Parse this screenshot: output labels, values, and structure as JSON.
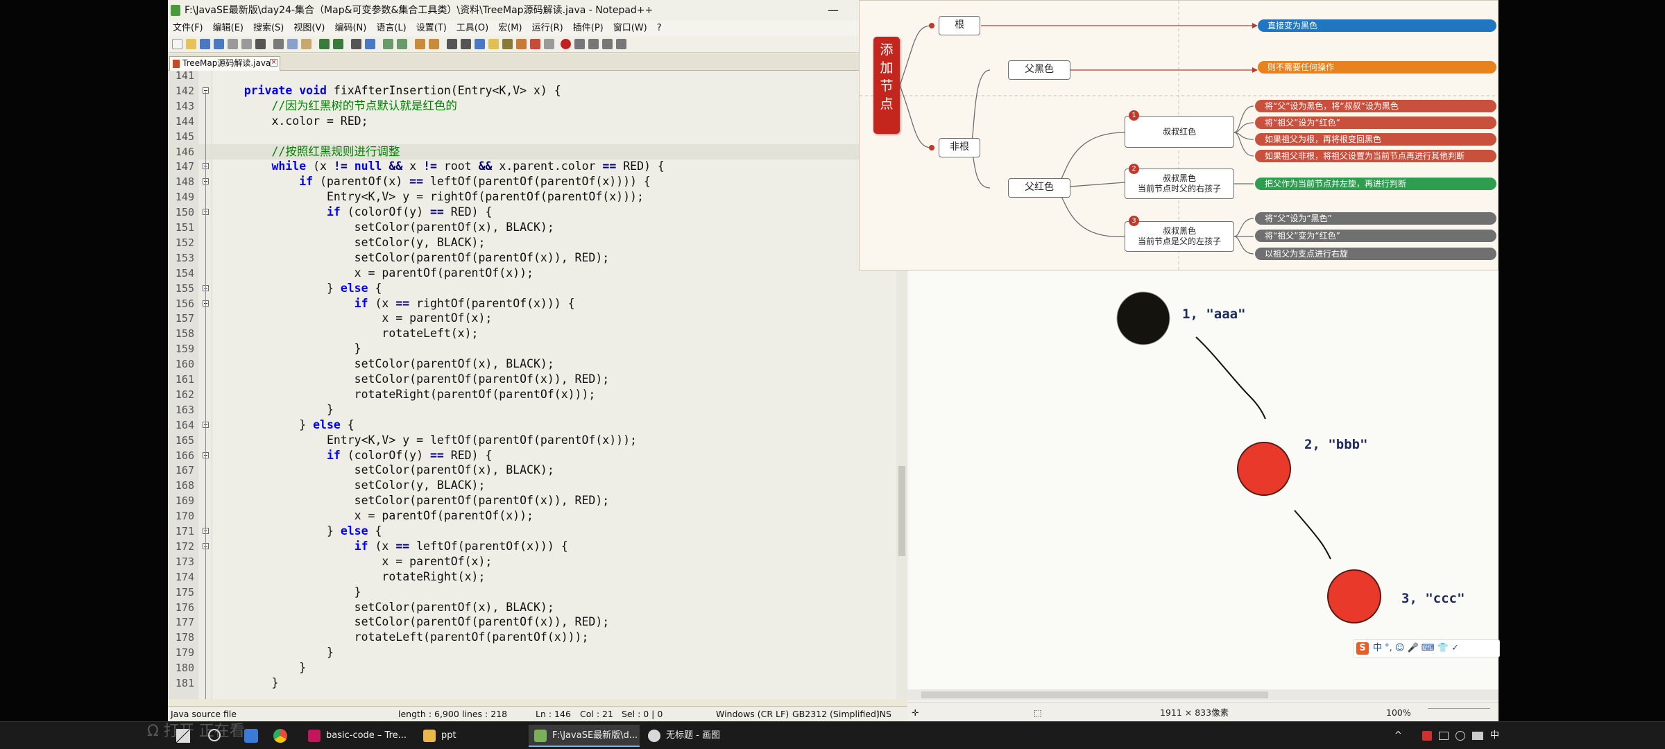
{
  "notepad": {
    "title": "F:\\JavaSE最新版\\day24-集合（Map&可变参数&集合工具类）\\资料\\TreeMap源码解读.java - Notepad++",
    "menu": [
      "文件(F)",
      "编辑(E)",
      "搜索(S)",
      "视图(V)",
      "编码(N)",
      "语言(L)",
      "设置(T)",
      "工具(O)",
      "宏(M)",
      "运行(R)",
      "插件(P)",
      "窗口(W)",
      "?"
    ],
    "tab_label": "TreeMap源码解读.java",
    "lines": [
      {
        "n": "141",
        "code": ""
      },
      {
        "n": "142",
        "code": "    private void fixAfterInsertion(Entry<K,V> x) {"
      },
      {
        "n": "143",
        "code": "        //因为红黑树的节点默认就是红色的"
      },
      {
        "n": "144",
        "code": "        x.color = RED;"
      },
      {
        "n": "145",
        "code": ""
      },
      {
        "n": "146",
        "code": "        //按照红黑规则进行调整"
      },
      {
        "n": "147",
        "code": "        while (x != null && x != root && x.parent.color == RED) {"
      },
      {
        "n": "148",
        "code": "            if (parentOf(x) == leftOf(parentOf(parentOf(x)))) {"
      },
      {
        "n": "149",
        "code": "                Entry<K,V> y = rightOf(parentOf(parentOf(x)));"
      },
      {
        "n": "150",
        "code": "                if (colorOf(y) == RED) {"
      },
      {
        "n": "151",
        "code": "                    setColor(parentOf(x), BLACK);"
      },
      {
        "n": "152",
        "code": "                    setColor(y, BLACK);"
      },
      {
        "n": "153",
        "code": "                    setColor(parentOf(parentOf(x)), RED);"
      },
      {
        "n": "154",
        "code": "                    x = parentOf(parentOf(x));"
      },
      {
        "n": "155",
        "code": "                } else {"
      },
      {
        "n": "156",
        "code": "                    if (x == rightOf(parentOf(x))) {"
      },
      {
        "n": "157",
        "code": "                        x = parentOf(x);"
      },
      {
        "n": "158",
        "code": "                        rotateLeft(x);"
      },
      {
        "n": "159",
        "code": "                    }"
      },
      {
        "n": "160",
        "code": "                    setColor(parentOf(x), BLACK);"
      },
      {
        "n": "161",
        "code": "                    setColor(parentOf(parentOf(x)), RED);"
      },
      {
        "n": "162",
        "code": "                    rotateRight(parentOf(parentOf(x)));"
      },
      {
        "n": "163",
        "code": "                }"
      },
      {
        "n": "164",
        "code": "            } else {"
      },
      {
        "n": "165",
        "code": "                Entry<K,V> y = leftOf(parentOf(parentOf(x)));"
      },
      {
        "n": "166",
        "code": "                if (colorOf(y) == RED) {"
      },
      {
        "n": "167",
        "code": "                    setColor(parentOf(x), BLACK);"
      },
      {
        "n": "168",
        "code": "                    setColor(y, BLACK);"
      },
      {
        "n": "169",
        "code": "                    setColor(parentOf(parentOf(x)), RED);"
      },
      {
        "n": "170",
        "code": "                    x = parentOf(parentOf(x));"
      },
      {
        "n": "171",
        "code": "                } else {"
      },
      {
        "n": "172",
        "code": "                    if (x == leftOf(parentOf(x))) {"
      },
      {
        "n": "173",
        "code": "                        x = parentOf(x);"
      },
      {
        "n": "174",
        "code": "                        rotateRight(x);"
      },
      {
        "n": "175",
        "code": "                    }"
      },
      {
        "n": "176",
        "code": "                    setColor(parentOf(x), BLACK);"
      },
      {
        "n": "177",
        "code": "                    setColor(parentOf(parentOf(x)), RED);"
      },
      {
        "n": "178",
        "code": "                    rotateLeft(parentOf(parentOf(x)));"
      },
      {
        "n": "179",
        "code": "                }"
      },
      {
        "n": "180",
        "code": "            }"
      },
      {
        "n": "181",
        "code": "        }"
      }
    ],
    "status": {
      "filetype": "Java source file",
      "length": "length : 6,900",
      "lines": "lines : 218",
      "ln": "Ln : 146",
      "col": "Col : 21",
      "sel": "Sel : 0 | 0",
      "eol": "Windows (CR LF)",
      "encoding": "GB2312 (Simplified)",
      "mode": "INS"
    }
  },
  "mindmap": {
    "root": "添加节点",
    "branch_root": "根",
    "branch_nonroot": "非根",
    "parent_black": "父黑色",
    "parent_red": "父红色",
    "case1": "叔叔红色",
    "case2_line1": "叔叔黑色",
    "case2_line2": "当前节点时父的右孩子",
    "case3_line1": "叔叔黑色",
    "case3_line2": "当前节点是父的左孩子",
    "badges": [
      "1",
      "2",
      "3"
    ],
    "pills": {
      "root_action": "直接变为黑色",
      "black_action": "则不需要任何操作",
      "c1a": "将“父”设为黑色，将“叔叔”设为黑色",
      "c1b": "将“祖父”设为“红色”",
      "c1c": "如果祖父为根，再将根变回黑色",
      "c1d": "如果祖父非根，将祖父设置为当前节点再进行其他判断",
      "c2a": "把父作为当前节点并左旋，再进行判断",
      "c3a": "将“父”设为“黑色”",
      "c3b": "将“祖父”变为“红色”",
      "c3c": "以祖父为支点进行右旋"
    },
    "colors": {
      "blue": "#2176c1",
      "orange": "#e8821e",
      "red": "#c9503c",
      "green": "#2f9d4f",
      "gray": "#707070"
    }
  },
  "paint": {
    "nodes": [
      {
        "label": "1, \"aaa\"",
        "color": "#15130e"
      },
      {
        "label": "2, \"bbb\"",
        "color": "#e8392a"
      },
      {
        "label": "3, \"ccc\"",
        "color": "#e8392a"
      }
    ],
    "status_size": "1911 × 833像素",
    "zoom": "100%"
  },
  "ime": {
    "s_label": "S",
    "text": "中 °, ☺ 🎤 ⌨ 👕 ✓"
  },
  "watermark": "Ω 打开 正在看",
  "taskbar": {
    "items": [
      "basic-code – Tre...",
      "ppt",
      "F:\\JavaSE最新版\\d...",
      "无标题 - 画图"
    ],
    "tray_text": "中"
  }
}
